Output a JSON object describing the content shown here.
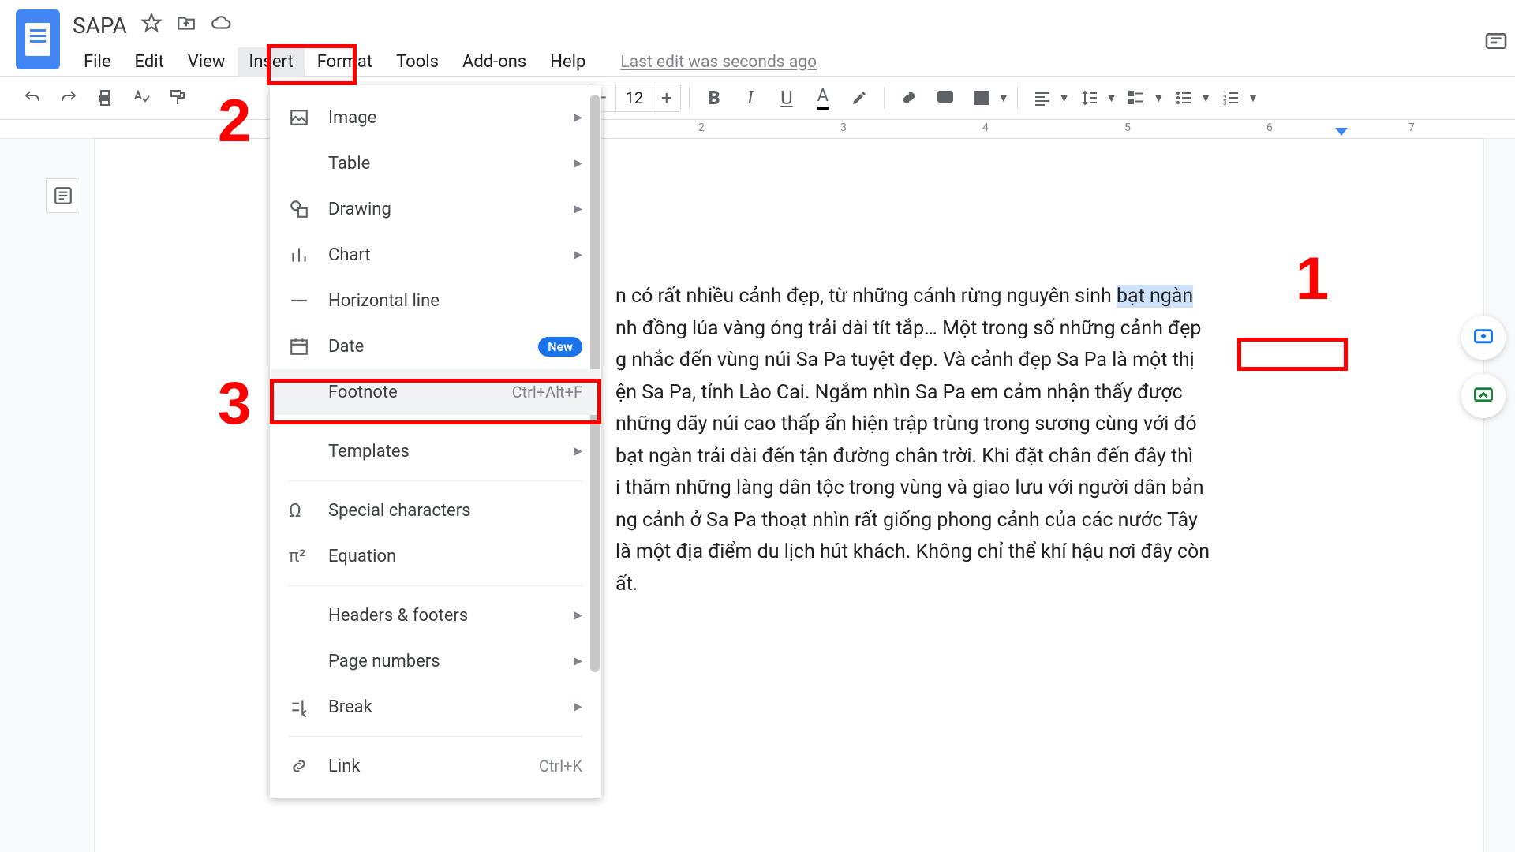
{
  "doc": {
    "title": "SAPA",
    "last_edit": "Last edit was seconds ago"
  },
  "menus": {
    "file": "File",
    "edit": "Edit",
    "view": "View",
    "insert": "Insert",
    "format": "Format",
    "tools": "Tools",
    "addons": "Add-ons",
    "help": "Help"
  },
  "toolbar": {
    "font_size": "12"
  },
  "ruler": {
    "m2": "2",
    "m3": "3",
    "m4": "4",
    "m5": "5",
    "m6": "6",
    "m7": "7"
  },
  "dropdown": {
    "image": "Image",
    "table": "Table",
    "drawing": "Drawing",
    "chart": "Chart",
    "hline": "Horizontal line",
    "date": "Date",
    "date_badge": "New",
    "footnote": "Footnote",
    "footnote_shortcut": "Ctrl+Alt+F",
    "templates": "Templates",
    "special": "Special characters",
    "equation": "Equation",
    "headers": "Headers & footers",
    "pagenums": "Page numbers",
    "break": "Break",
    "link": "Link",
    "link_shortcut": "Ctrl+K"
  },
  "callouts": {
    "n1": "1",
    "n2": "2",
    "n3": "3"
  },
  "body": {
    "pre": "n có rất nhiều cảnh đẹp, từ những cánh rừng nguyên sinh ",
    "sel": "bạt ngàn",
    "post1": "nh đồng lúa vàng óng trải dài tít tắp… Một trong số những cảnh đẹp",
    "post2": "g nhắc đến vùng núi Sa Pa tuyệt đẹp. Và cảnh đẹp Sa Pa là một thị",
    "post3": "ện Sa Pa, tỉnh Lào Cai. Ngắm nhìn Sa Pa em cảm nhận thấy được",
    "post4": "những dãy núi cao thấp ẩn hiện trập trùng trong sương cùng với đó",
    "post5": " bạt ngàn trải dài đến tận đường chân trời. Khi đặt chân đến đây thì",
    "post6": "i thăm những làng dân tộc trong vùng và giao lưu với người dân bản",
    "post7": "ng cảnh ở Sa Pa thoạt nhìn rất giống phong cảnh của các nước Tây",
    "post8": "là một địa điểm du lịch hút khách. Không chỉ thể khí hậu nơi đây còn",
    "post9": "ất."
  }
}
